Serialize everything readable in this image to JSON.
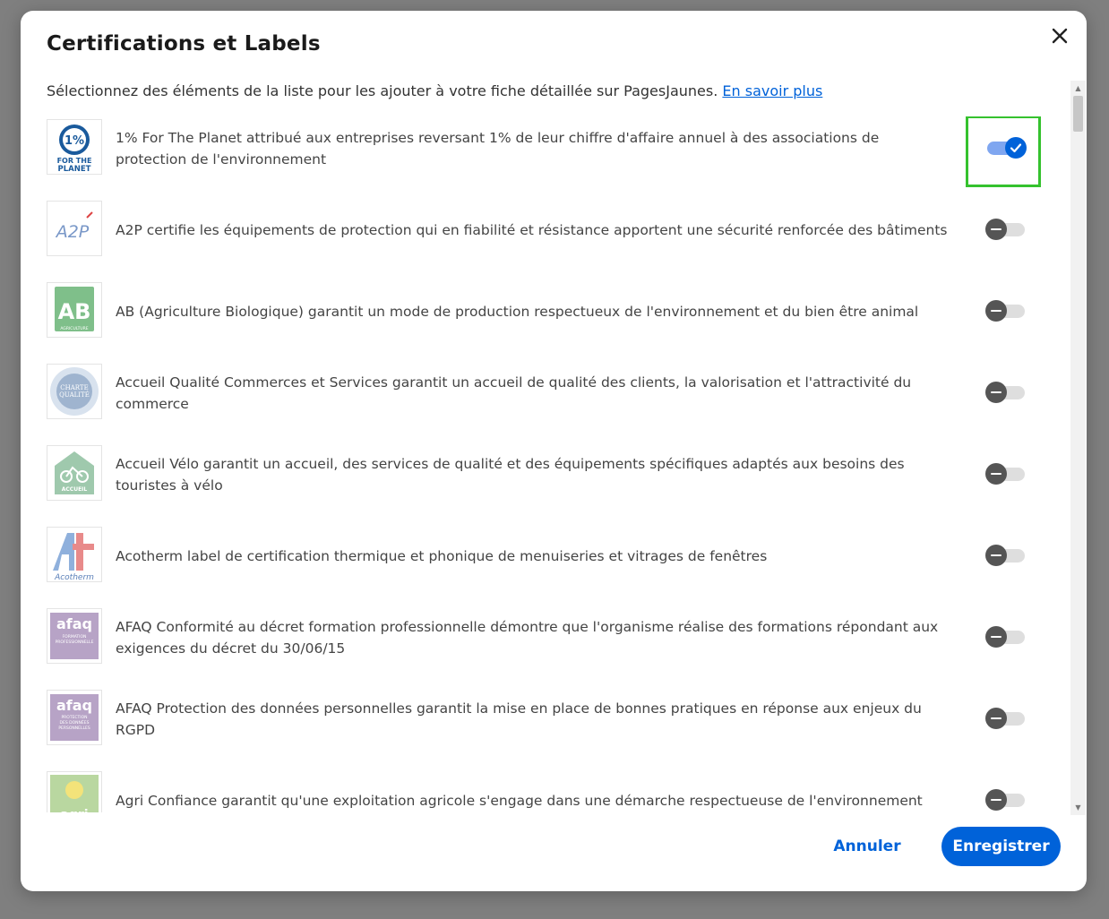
{
  "dialog": {
    "title": "Certifications et Labels",
    "close_icon": "close-icon",
    "intro_text": "Sélectionnez des éléments de la liste pour les ajouter à votre fiche détaillée sur PagesJaunes.",
    "learn_more_link": "En savoir plus"
  },
  "certifications": [
    {
      "label": "1% For The Planet attribué aux entreprises reversant 1% de leur chiffre d'affaire annuel à des associations de protection de l'environnement",
      "enabled": true,
      "logo_text": "1%",
      "logo_caption": "FOR THE PLANET"
    },
    {
      "label": "A2P certifie les équipements de protection qui en fiabilité et résistance apportent une sécurité renforcée des bâtiments",
      "enabled": false,
      "logo_text": "A2P"
    },
    {
      "label": "AB (Agriculture Biologique) garantit un mode de production respectueux de l'environnement et du bien être animal",
      "enabled": false,
      "logo_text": "AB",
      "logo_caption": "AGRICULTURE BIOLOGIQUE"
    },
    {
      "label": "Accueil Qualité Commerces et Services garantit un accueil de qualité des clients, la valorisation et l'attractivité du commerce",
      "enabled": false,
      "logo_text": "CHARTE QUALITÉ"
    },
    {
      "label": "Accueil Vélo garantit un accueil, des services de qualité et des équipements spécifiques adaptés aux besoins des touristes à vélo",
      "enabled": false,
      "logo_text": "ACCUEIL VÉLO"
    },
    {
      "label": "Acotherm label de certification thermique et phonique de menuiseries et vitrages de fenêtres",
      "enabled": false,
      "logo_text": "Acotherm"
    },
    {
      "label": "AFAQ Conformité au décret formation professionnelle démontre que l'organisme réalise des formations répondant aux exigences du décret du 30/06/15",
      "enabled": false,
      "logo_text": "afaq",
      "logo_caption": "FORMATION PROFESSIONNELLE"
    },
    {
      "label": "AFAQ Protection des données personnelles garantit la mise en place de bonnes pratiques en réponse aux enjeux du RGPD",
      "enabled": false,
      "logo_text": "afaq",
      "logo_caption": "PROTECTION DES DONNÉES PERSONNELLES"
    },
    {
      "label": "Agri Confiance garantit qu'une exploitation agricole s'engage dans une démarche respectueuse de l'environnement",
      "enabled": false,
      "logo_text": "agri"
    }
  ],
  "footer": {
    "cancel_label": "Annuler",
    "save_label": "Enregistrer"
  },
  "colors": {
    "accent": "#0062d9",
    "highlight_box": "#35c22e",
    "toggle_off": "#555555"
  }
}
